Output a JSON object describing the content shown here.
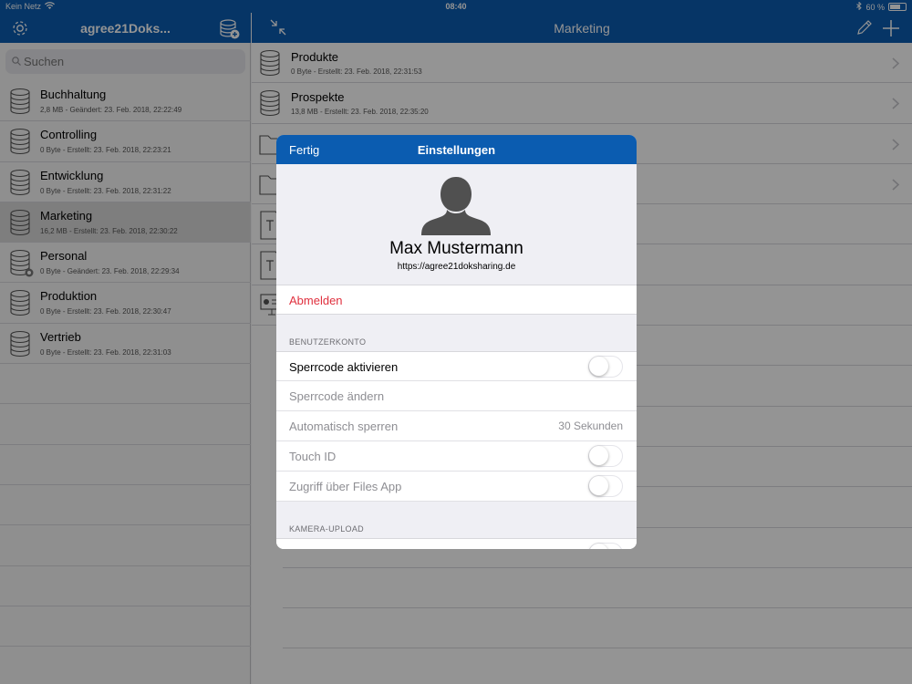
{
  "status_bar": {
    "carrier": "Kein Netz",
    "time": "08:40",
    "battery_percent": "60 %",
    "battery_level": 0.6
  },
  "sidebar": {
    "title": "agree21Doks...",
    "search_placeholder": "Suchen",
    "items": [
      {
        "label": "Buchhaltung",
        "meta": "2,8 MB - Geändert: 23. Feb. 2018, 22:22:49",
        "badge": false
      },
      {
        "label": "Controlling",
        "meta": "0 Byte - Erstellt: 23. Feb. 2018, 22:23:21",
        "badge": false
      },
      {
        "label": "Entwicklung",
        "meta": "0 Byte - Erstellt: 23. Feb. 2018, 22:31:22",
        "badge": false
      },
      {
        "label": "Marketing",
        "meta": "16,2 MB - Erstellt: 23. Feb. 2018, 22:30:22",
        "badge": false,
        "selected": true
      },
      {
        "label": "Personal",
        "meta": "0 Byte - Geändert: 23. Feb. 2018, 22:29:34",
        "badge": true
      },
      {
        "label": "Produktion",
        "meta": "0 Byte - Erstellt: 23. Feb. 2018, 22:30:47",
        "badge": false
      },
      {
        "label": "Vertrieb",
        "meta": "0 Byte - Erstellt: 23. Feb. 2018, 22:31:03",
        "badge": false
      }
    ]
  },
  "main": {
    "title": "Marketing",
    "items": [
      {
        "label": "Produkte",
        "meta": "0 Byte - Erstellt: 23. Feb. 2018, 22:31:53",
        "icon": "database-icon"
      },
      {
        "label": "Prospekte",
        "meta": "13,8 MB - Erstellt: 23. Feb. 2018, 22:35:20",
        "icon": "database-icon"
      },
      {
        "label": "",
        "meta": "",
        "icon": "folder-icon"
      },
      {
        "label": "",
        "meta": "",
        "icon": "folder-icon"
      },
      {
        "label": "",
        "meta": "",
        "icon": "text-file-icon"
      },
      {
        "label": "",
        "meta": "",
        "icon": "text-file-icon"
      },
      {
        "label": "",
        "meta": "",
        "icon": "presentation-file-icon"
      }
    ]
  },
  "modal": {
    "done_label": "Fertig",
    "title": "Einstellungen",
    "user_name": "Max Mustermann",
    "user_url": "https://agree21doksharing.de",
    "logout_label": "Abmelden",
    "account_section": "BENUTZERKONTO",
    "settings": [
      {
        "label": "Sperrcode aktivieren",
        "type": "toggle",
        "on": false,
        "enabled": true
      },
      {
        "label": "Sperrcode ändern",
        "type": "plain",
        "enabled": false
      },
      {
        "label": "Automatisch sperren",
        "type": "value",
        "value": "30 Sekunden",
        "enabled": false
      },
      {
        "label": "Touch ID",
        "type": "toggle",
        "on": false,
        "enabled": false
      },
      {
        "label": "Zugriff über Files App",
        "type": "toggle",
        "on": false,
        "enabled": false
      }
    ],
    "camera_section": "KAMERA-UPLOAD"
  },
  "colors": {
    "brand_blue": "#0b5cb0",
    "destructive_red": "#e0303e"
  }
}
